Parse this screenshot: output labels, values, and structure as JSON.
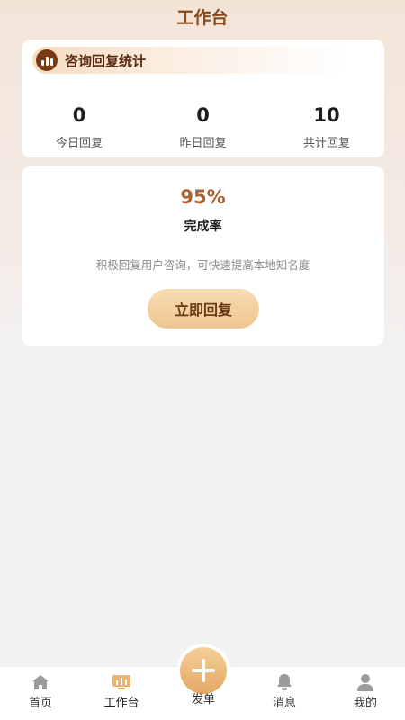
{
  "header": {
    "title": "工作台"
  },
  "stats": {
    "title": "咨询回复统计",
    "items": [
      {
        "value": "0",
        "label": "今日回复"
      },
      {
        "value": "0",
        "label": "昨日回复"
      },
      {
        "value": "10",
        "label": "共计回复"
      }
    ]
  },
  "completion": {
    "rate": "95%",
    "label": "完成率",
    "description": "积极回复用户咨询，可快速提高本地知名度",
    "button_label": "立即回复"
  },
  "tabbar": {
    "items": [
      {
        "label": "首页",
        "icon": "home-icon"
      },
      {
        "label": "工作台",
        "icon": "workbench-icon"
      },
      {
        "label": "发单",
        "icon": "plus-icon"
      },
      {
        "label": "消息",
        "icon": "bell-icon"
      },
      {
        "label": "我的",
        "icon": "user-icon"
      }
    ]
  },
  "colors": {
    "accent": "#a96132",
    "brand_dark": "#7a3a14",
    "button_gradient_top": "#f7ddb1",
    "button_gradient_bottom": "#efc58f"
  }
}
